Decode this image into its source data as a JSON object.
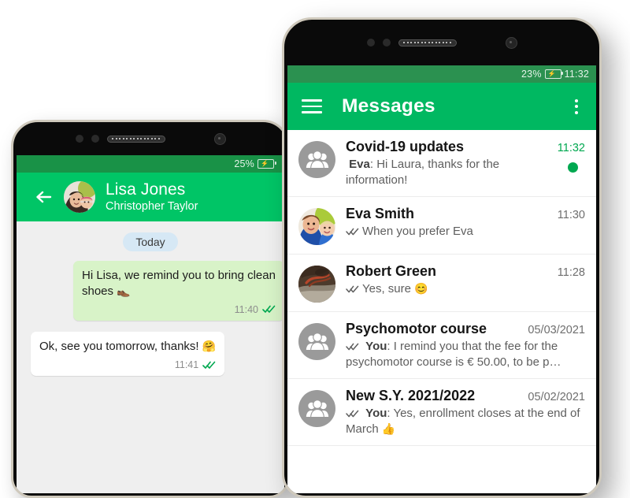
{
  "left_phone": {
    "status_bar": {
      "battery_percent": "25%",
      "time": "",
      "battery_icon": "battery-charging-icon"
    },
    "app_bar": {
      "back_icon": "back-arrow-icon",
      "avatar": "contact-avatar",
      "title": "Lisa Jones",
      "subtitle": "Christopher Taylor"
    },
    "conversation": {
      "day_divider": "Today",
      "messages": [
        {
          "direction": "outgoing",
          "text": "Hi Lisa, we remind you to bring clean shoes ",
          "emoji": "👞",
          "time": "11:40",
          "ticks": "double-check-icon",
          "tick_color": "#00a850"
        },
        {
          "direction": "incoming",
          "text": "Ok, see you tomorrow, thanks! ",
          "emoji": "🤗",
          "time": "11:41",
          "ticks": "double-check-icon",
          "tick_color": "#00a850"
        }
      ]
    }
  },
  "right_phone": {
    "status_bar": {
      "battery_percent": "23%",
      "time": "11:32",
      "battery_icon": "battery-charging-icon"
    },
    "app_bar": {
      "menu_icon": "hamburger-menu-icon",
      "title": "Messages",
      "overflow_icon": "kebab-menu-icon"
    },
    "conversations": [
      {
        "avatar_type": "group",
        "name": "Covid-19 updates",
        "sender": "Eva",
        "preview": ": Hi Laura, thanks for the information!",
        "time": "11:32",
        "unread": true,
        "ticks": false
      },
      {
        "avatar_type": "photo-woman-child",
        "name": "Eva Smith",
        "sender": "",
        "preview": "When you prefer Eva",
        "time": "11:30",
        "unread": false,
        "ticks": true
      },
      {
        "avatar_type": "photo-dark",
        "name": "Robert Green",
        "sender": "",
        "preview": "Yes, sure ",
        "emoji": "😊",
        "time": "11:28",
        "unread": false,
        "ticks": true
      },
      {
        "avatar_type": "group",
        "name": "Psychomotor course",
        "sender": "You",
        "preview": ": I remind you that the fee for the psychomotor course is € 50.00, to be p…",
        "time": "05/03/2021",
        "unread": false,
        "ticks": true
      },
      {
        "avatar_type": "group",
        "name": "New S.Y. 2021/2022",
        "sender": "You",
        "preview": ": Yes, enrollment closes at the end of March ",
        "emoji": "👍",
        "time": "05/02/2021",
        "unread": false,
        "ticks": true
      }
    ]
  },
  "colors": {
    "app_bar_green": "#00b861",
    "status_bar_green": "#2b9150",
    "chat_app_bar_green": "#00c566",
    "accent_green": "#00a850",
    "outgoing_bubble": "#d8f3c8",
    "incoming_bubble": "#ffffff",
    "chat_background": "#efefef",
    "day_chip": "#d6e8f5"
  }
}
